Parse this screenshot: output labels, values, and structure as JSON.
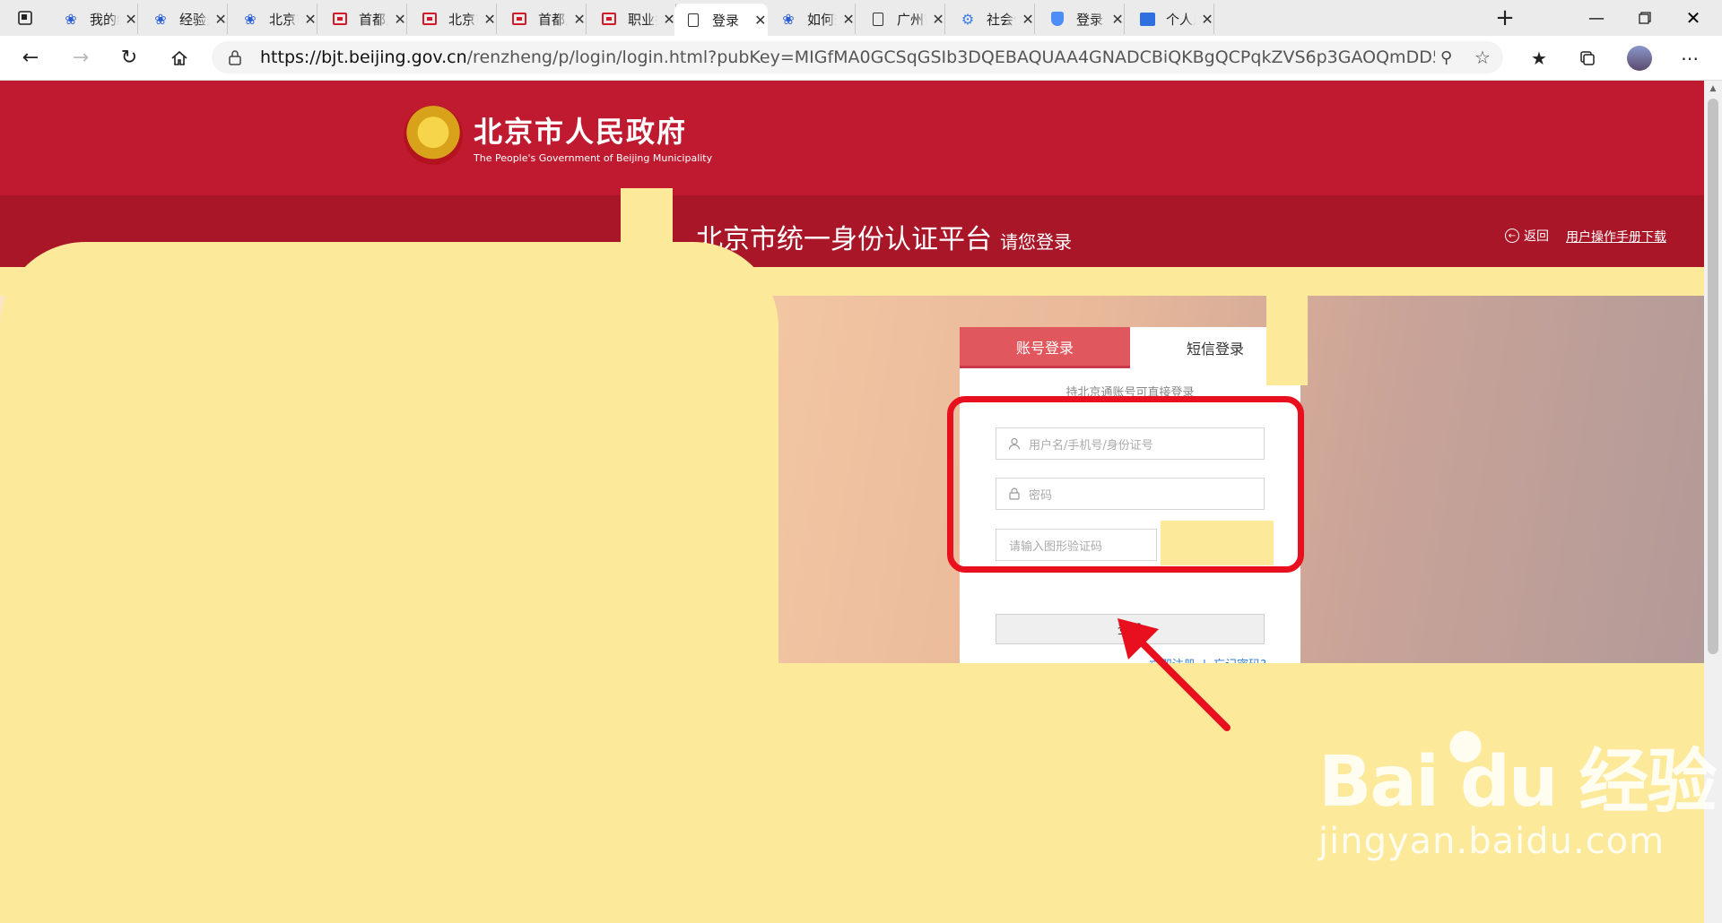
{
  "browser": {
    "tabs": [
      {
        "title": "我的经验",
        "icon": "paw-icon"
      },
      {
        "title": "经验是",
        "icon": "paw-icon"
      },
      {
        "title": "北京市",
        "icon": "paw-icon"
      },
      {
        "title": "首都之窗",
        "icon": "gov-red-icon"
      },
      {
        "title": "北京市",
        "icon": "gov-red-icon"
      },
      {
        "title": "首都之窗",
        "icon": "gov-red-icon"
      },
      {
        "title": "职业技",
        "icon": "gov-red-icon"
      },
      {
        "title": "登录",
        "icon": "document-icon",
        "active": true
      },
      {
        "title": "如何查",
        "icon": "paw-icon"
      },
      {
        "title": "广州市",
        "icon": "document-icon"
      },
      {
        "title": "社会保",
        "icon": "gear-icon"
      },
      {
        "title": "登录",
        "icon": "shield-icon"
      },
      {
        "title": "个人风",
        "icon": "db-icon"
      }
    ],
    "url_host": "https://bjt.beijing.gov.cn",
    "url_rest": "/renzheng/p/login/login.html?pubKey=MIGfMA0GCSqGSIb3DQEBAQUAA4GNADCBiQKBgQCPqkZVS6p3GAOQmDD5CF..."
  },
  "header": {
    "gov_name": "北京市人民政府",
    "gov_name_en": "The People's Government of Beijing Municipality"
  },
  "platform": {
    "title": "北京市统一身份认证平台",
    "subtitle": "请您登录",
    "back_label": "返回",
    "manual_label": "用户操作手册下载"
  },
  "login": {
    "tab_account": "账号登录",
    "tab_sms": "短信登录",
    "note": "持北京通账号可直接登录",
    "username_placeholder": "用户名/手机号/身份证号",
    "password_placeholder": "密码",
    "captcha_placeholder": "请输入图形验证码",
    "submit_label": "登录",
    "register_label": "立即注册",
    "separator": "|",
    "forgot_label": "忘记密码?"
  },
  "watermark": {
    "logo": "Bai  du 经验",
    "url": "jingyan.baidu.com"
  },
  "colors": {
    "header_red": "#bf1a2f",
    "tab_active": "#e0585e",
    "highlight": "#e8101f",
    "cover_yellow": "#fde99a"
  }
}
